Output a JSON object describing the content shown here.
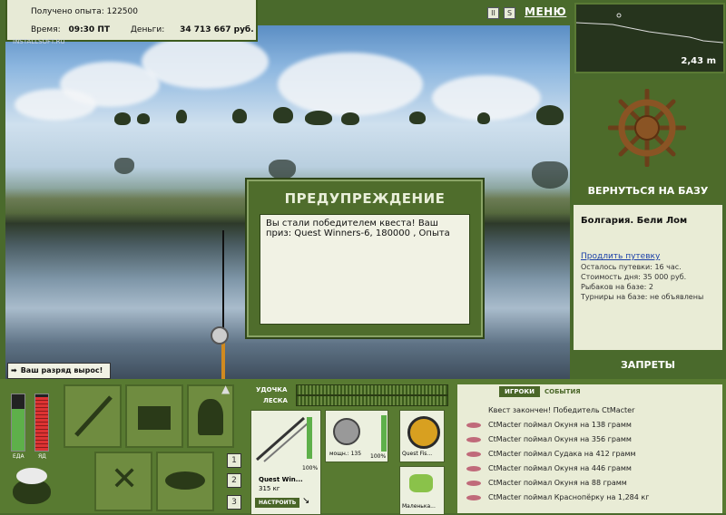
{
  "info": {
    "exp_label": "Получено опыта:",
    "exp_value": "122500",
    "time_label": "Время:",
    "time_value": "09:30 ПТ",
    "money_label": "Деньги:",
    "money_value": "34 713 667 руб.",
    "watermark": "INSTALLSOFT.RU"
  },
  "toolbar": {
    "menu_label": "МЕНЮ",
    "pause_label": "II",
    "sound_label": "S"
  },
  "depth": {
    "value_label": "2,43 m"
  },
  "base": {
    "return_label": "ВЕРНУТЬСЯ НА БАЗУ"
  },
  "location": {
    "title": "Болгария. Бели Лом",
    "extend_link": "Продлить путевку",
    "remaining": "Осталось путевки: 16 час.",
    "cost": "Стоимость дня: 35 000 руб.",
    "fishers": "Рыбаков на базе: 2",
    "tournaments": "Турниры на базе: не объявлены"
  },
  "bans": {
    "label": "ЗАПРЕТЫ"
  },
  "dialog": {
    "title": "ПРЕДУПРЕЖДЕНИЕ",
    "message": "Вы стали победителем квеста! Ваш приз: Quest Winners-6, 180000 , Опыта"
  },
  "rank": {
    "label": "Ваш разряд вырос!"
  },
  "needs": {
    "food_label": "ЕДА",
    "poison_label": "ЯД",
    "food_level": 0.75,
    "poison_level": 0.95
  },
  "tackle": {
    "rod_gauge_label": "УДОЧКА",
    "line_gauge_label": "ЛЕСКА",
    "rod_name": "Quest Win...",
    "rod_weight": "315 кг",
    "rod_percent": "100%",
    "reel_label": "мощн.: 135",
    "reel_percent": "100%",
    "line_name": "Quest Fis...",
    "lure_name": "Маленька...",
    "configure_button": "НАСТРОИТЬ"
  },
  "slots": {
    "slot1": "1",
    "slot2": "2",
    "slot3": "3"
  },
  "events": {
    "tab_players": "ИГРОКИ",
    "tab_events": "СОБЫТИЯ",
    "quest_done": "Квест закончен! Победитель CtMacter",
    "items": [
      "CtMacter поймал Окуня на 138 грамм",
      "CtMacter поймал Окуня на 356 грамм",
      "CtMacter поймал Судака на 412 грамм",
      "CtMacter поймал Окуня на 446 грамм",
      "CtMacter поймал Окуня на 88 грамм",
      "CtMacter поймал Краснопёрку на 1,284 кг"
    ]
  },
  "colors": {
    "panel_green": "#4d6b2a",
    "info_bg": "#e7ead6",
    "link_blue": "#1a3fa8"
  }
}
